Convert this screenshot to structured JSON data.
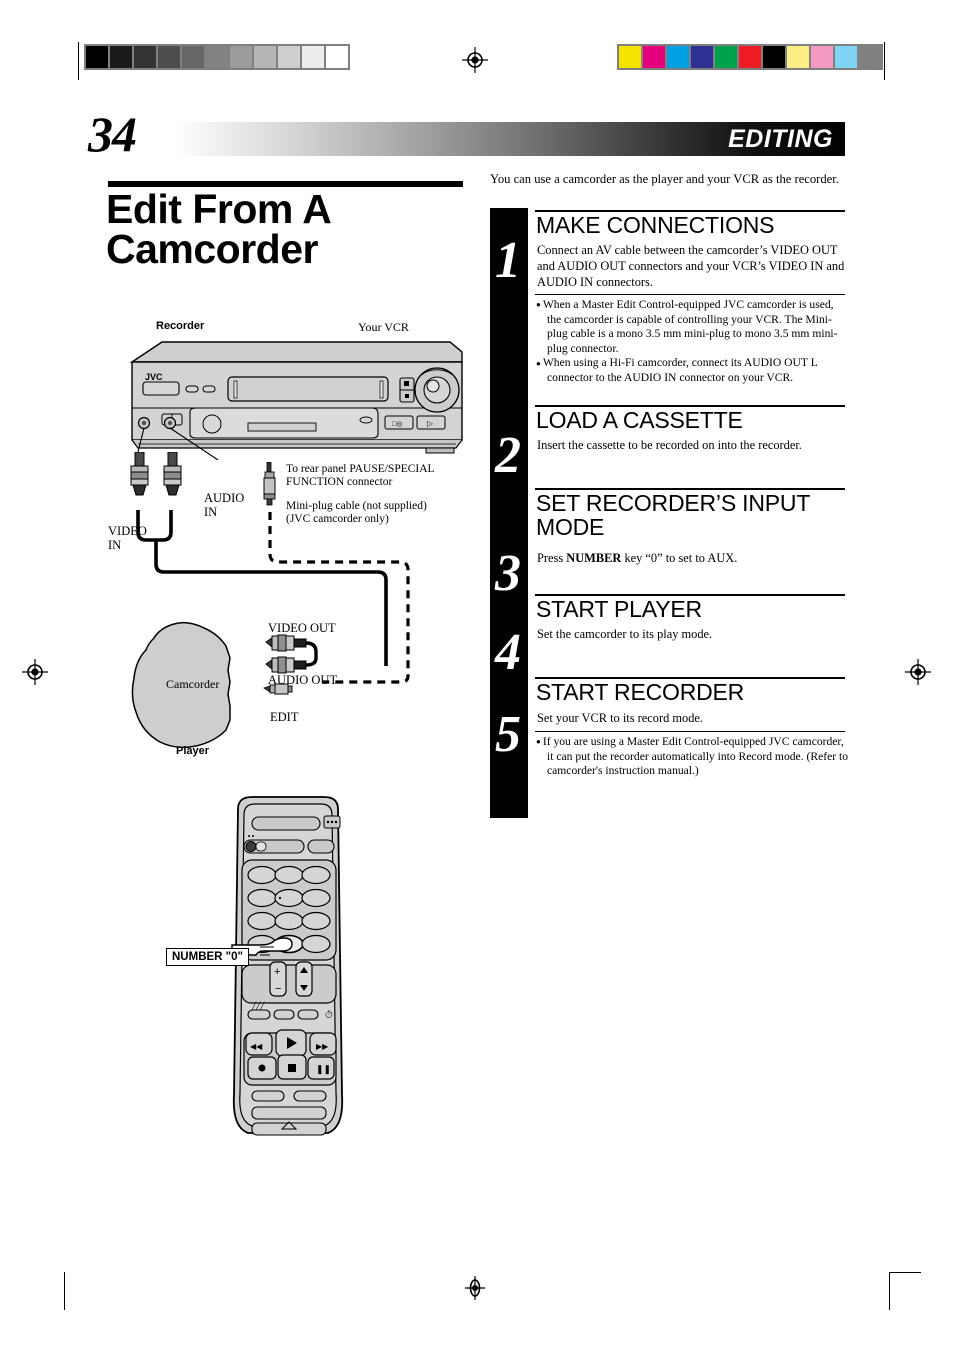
{
  "page": {
    "number": "34",
    "section_banner": "EDITING",
    "title": "Edit From A Camcorder"
  },
  "intro": "You can use a camcorder as the player and your VCR as the recorder.",
  "steps": [
    {
      "number": "1",
      "heading": "MAKE CONNECTIONS",
      "body": "Connect an AV cable between the camcorder’s VIDEO OUT and AUDIO OUT connectors and your VCR’s VIDEO IN and AUDIO IN connectors.",
      "bullets": [
        "When a Master Edit Control-equipped JVC camcorder is used, the camcorder is capable of controlling your VCR. The Mini-plug cable is a mono 3.5 mm mini-plug to mono 3.5 mm mini-plug connector.",
        "When using a Hi-Fi camcorder, connect its AUDIO OUT L connector to the AUDIO IN connector on your VCR."
      ]
    },
    {
      "number": "2",
      "heading": "LOAD A CASSETTE",
      "body": "Insert the cassette to be recorded on into the recorder.",
      "bullets": []
    },
    {
      "number": "3",
      "heading": "SET RECORDER’S INPUT MODE",
      "body_prefix": "Press ",
      "body_bold": "NUMBER",
      "body_suffix": " key “0” to set to AUX.",
      "bullets": []
    },
    {
      "number": "4",
      "heading": "START PLAYER",
      "body": "Set the camcorder to its play mode.",
      "bullets": []
    },
    {
      "number": "5",
      "heading": "START RECORDER",
      "body": "Set your VCR to its record mode.",
      "bullets": [
        "If you are using a Master Edit Control-equipped JVC camcorder, it can put the recorder automatically into Record mode. (Refer to camcorder's instruction manual.)"
      ]
    }
  ],
  "diagram": {
    "recorder_label": "Recorder",
    "your_vcr_label": "Your VCR",
    "vcr_brand": "JVC",
    "video_in": "VIDEO\nIN",
    "audio_in": "AUDIO\nIN",
    "rear_panel_note": "To rear panel PAUSE/SPECIAL\nFUNCTION connector",
    "miniplug_note": "Mini-plug cable (not supplied)\n(JVC camcorder only)",
    "camcorder_label": "Camcorder",
    "player_label": "Player",
    "video_out": "VIDEO OUT",
    "audio_out": "AUDIO OUT",
    "edit": "EDIT",
    "callout_number_zero": "NUMBER \"0\""
  },
  "print_marks": {
    "grayscale_swatches": [
      "#000000",
      "#1a1a1a",
      "#333333",
      "#4d4d4d",
      "#666666",
      "#828282",
      "#9b9b9b",
      "#b5b5b5",
      "#cfcfcf",
      "#ececec",
      "#ffffff"
    ],
    "color_swatches": [
      "#f5e400",
      "#e5007e",
      "#00a0e2",
      "#2e3192",
      "#00a14b",
      "#ed1c24",
      "#000000",
      "#faee85",
      "#f49ac1",
      "#7fd4f4",
      "#808080"
    ]
  }
}
